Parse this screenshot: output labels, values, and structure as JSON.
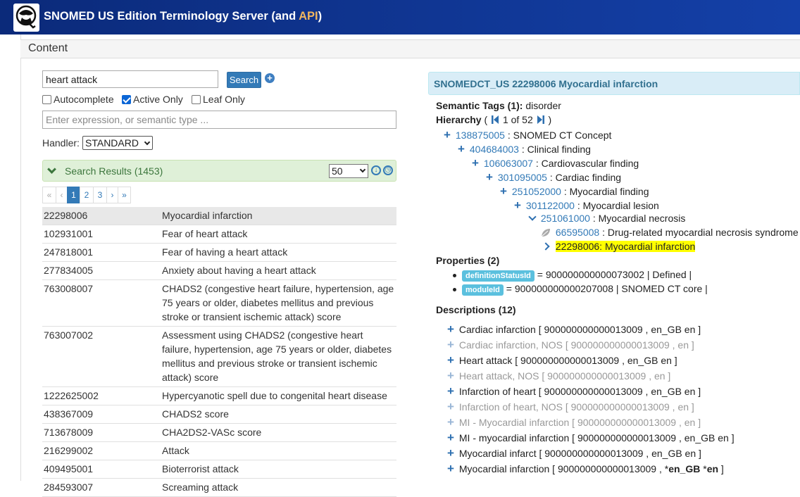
{
  "header": {
    "title_main": "SNOMED US Edition Terminology Server (and ",
    "title_api": "API",
    "title_end": ")"
  },
  "content_label": "Content",
  "search": {
    "query": "heart attack",
    "button_label": "Search",
    "autocomplete_label": "Autocomplete",
    "active_only_label": "Active Only",
    "leaf_only_label": "Leaf Only",
    "expression_placeholder": "Enter expression, or semantic type ...",
    "handler_label": "Handler:",
    "handler_value": "STANDARD"
  },
  "results": {
    "title": "Search Results (1453)",
    "per_page": "50",
    "pager": [
      "«",
      "‹",
      "1",
      "2",
      "3",
      "›",
      "»"
    ],
    "rows": [
      {
        "id": "22298006",
        "name": "Myocardial infarction"
      },
      {
        "id": "102931001",
        "name": "Fear of heart attack"
      },
      {
        "id": "247818001",
        "name": "Fear of having a heart attack"
      },
      {
        "id": "277834005",
        "name": "Anxiety about having a heart attack"
      },
      {
        "id": "763008007",
        "name": "CHADS2 (congestive heart failure, hypertension, age 75 years or older, diabetes mellitus and previous stroke or transient ischemic attack) score"
      },
      {
        "id": "763007002",
        "name": "Assessment using CHADS2 (congestive heart failure, hypertension, age 75 years or older, diabetes mellitus and previous stroke or transient ischemic attack) score"
      },
      {
        "id": "1222625002",
        "name": "Hypercyanotic spell due to congenital heart disease"
      },
      {
        "id": "438367009",
        "name": "CHADS2 score"
      },
      {
        "id": "713678009",
        "name": "CHA2DS2-VASc score"
      },
      {
        "id": "216299002",
        "name": "Attack"
      },
      {
        "id": "409495001",
        "name": "Bioterrorist attack"
      },
      {
        "id": "284593007",
        "name": "Screaming attack"
      }
    ]
  },
  "concept": {
    "header": "SNOMEDCT_US 22298006 Myocardial infarction",
    "semantic_tags_label": "Semantic Tags (1):",
    "semantic_tags_value": "disorder",
    "hierarchy_label": "Hierarchy",
    "hierarchy_paren_open": "(",
    "hierarchy_pos": "1 of 52",
    "hierarchy_paren_close": ")",
    "tree": [
      {
        "code": "138875005",
        "label": "SNOMED CT Concept"
      },
      {
        "code": "404684003",
        "label": "Clinical finding"
      },
      {
        "code": "106063007",
        "label": "Cardiovascular finding"
      },
      {
        "code": "301095005",
        "label": "Cardiac finding"
      },
      {
        "code": "251052000",
        "label": "Myocardial finding"
      },
      {
        "code": "301122000",
        "label": "Myocardial lesion"
      },
      {
        "code": "251061000",
        "label": "Myocardial necrosis"
      },
      {
        "code": "66595008",
        "label": "Drug-related myocardial necrosis syndrome"
      },
      {
        "current": "22298006: Myocardial infarction"
      }
    ],
    "properties_label": "Properties (2)",
    "properties": [
      {
        "badge": "definitionStatusId",
        "text": "= 900000000000073002 | Defined |"
      },
      {
        "badge": "moduleId",
        "text": "= 900000000000207008 | SNOMED CT core |"
      }
    ],
    "descriptions_label": "Descriptions (12)",
    "descriptions": [
      {
        "text": "Cardiac infarction [ 900000000000013009 , en_GB en ]",
        "inactive": false
      },
      {
        "text": "Cardiac infarction, NOS [ 900000000000013009 , en ]",
        "inactive": true
      },
      {
        "text": "Heart attack [ 900000000000013009 , en_GB en ]",
        "inactive": false
      },
      {
        "text": "Heart attack, NOS [ 900000000000013009 , en ]",
        "inactive": true
      },
      {
        "text": "Infarction of heart [ 900000000000013009 , en_GB en ]",
        "inactive": false
      },
      {
        "text": "Infarction of heart, NOS [ 900000000000013009 , en ]",
        "inactive": true
      },
      {
        "text": "MI - Myocardial infarction [ 900000000000013009 , en ]",
        "inactive": true
      },
      {
        "text": "MI - myocardial infarction [ 900000000000013009 , en_GB en ]",
        "inactive": false
      },
      {
        "text": "Myocardial infarct [ 900000000000013009 , en_GB en ]",
        "inactive": false
      },
      {
        "pre": "Myocardial infarction [ 900000000000013009 , *",
        "bold1": "en_GB",
        "mid": " *",
        "bold2": "en",
        "post": " ]",
        "inactive": false
      }
    ]
  }
}
